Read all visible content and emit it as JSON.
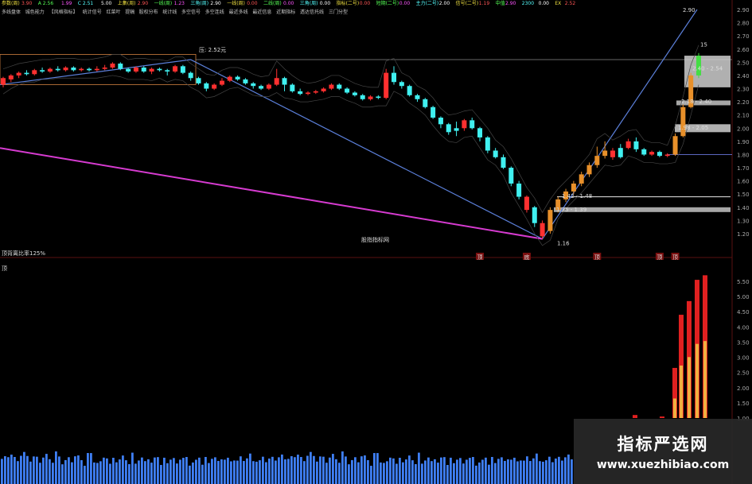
{
  "header": {
    "row1": [
      "参数(周)",
      "3.90",
      "A 2.56",
      "1.99",
      "C 2.51",
      "5.00",
      "上集(周)",
      "2.90",
      "一线(周)",
      "1.23",
      "三角(周)",
      "2.90",
      "一线(周)",
      "0.00",
      "二线(周)",
      "0.00",
      "三角(周)",
      "0.00",
      "指标(二号)",
      "0.00",
      "短期(二号)",
      "0.00",
      "主力(二号)",
      "2.00",
      "信号(二号)",
      "1.19",
      "中值",
      "2.90",
      "2300",
      "0.00",
      "EX",
      "2.52"
    ],
    "row2": [
      "多线盘体",
      "城色能力",
      "【风格指标】",
      "统计信号",
      "红菜叶",
      "提稿",
      "股权分布",
      "统计线",
      "多空信号",
      "多空连线",
      "最近多线",
      "最近信息",
      "近期指标",
      "透达信托线",
      "三门分型"
    ]
  },
  "annotations": {
    "resistance": "压: 2.52元",
    "label_290": "2.90",
    "label_315": "15",
    "box_240": "2.40 - 2.54",
    "box_218": "2.18 - 2.40",
    "box_198": "1.98 - 2.05",
    "box_142": "1.42 - 1.48",
    "box_135": "1.35 - 1.39",
    "low": "1.16",
    "center_text": "股指指标网",
    "left_bottom": "顶背离比率125%",
    "sub_label": "顶",
    "markers": [
      "顶",
      "底",
      "顶",
      "顶",
      "顶"
    ]
  },
  "watermark": {
    "title": "指标严选网",
    "url": "www.xuezhibiao.com"
  },
  "colors": {
    "up": "#ff3030",
    "down": "#40f0f0",
    "yellow_up": "#e8902a",
    "trend": "#5b7fd9",
    "magenta": "#d63bd0",
    "volume": "#3f7ff5"
  },
  "chart_data": {
    "type": "candlestick",
    "y_axis_ticks": [
      "2.90",
      "2.80",
      "2.70",
      "2.60",
      "2.50",
      "2.40",
      "2.30",
      "2.20",
      "2.10",
      "2.00",
      "1.90",
      "1.80",
      "1.70",
      "1.60",
      "1.50",
      "1.40",
      "1.30",
      "1.20"
    ],
    "sub_axis_ticks": [
      "5.50",
      "5.00",
      "4.50",
      "4.00",
      "3.50",
      "3.00",
      "2.50",
      "2.00",
      "1.50",
      "1.00"
    ],
    "candles": [
      [
        2.33,
        2.38,
        2.31,
        2.39,
        "u"
      ],
      [
        2.37,
        2.4,
        2.35,
        2.41,
        "u"
      ],
      [
        2.4,
        2.42,
        2.38,
        2.43,
        "u"
      ],
      [
        2.42,
        2.41,
        2.4,
        2.44,
        "d"
      ],
      [
        2.41,
        2.44,
        2.4,
        2.45,
        "u"
      ],
      [
        2.44,
        2.43,
        2.42,
        2.46,
        "d"
      ],
      [
        2.43,
        2.45,
        2.42,
        2.46,
        "u"
      ],
      [
        2.45,
        2.44,
        2.43,
        2.47,
        "d"
      ],
      [
        2.44,
        2.46,
        2.43,
        2.47,
        "u"
      ],
      [
        2.46,
        2.44,
        2.43,
        2.47,
        "d"
      ],
      [
        2.44,
        2.45,
        2.43,
        2.46,
        "u"
      ],
      [
        2.45,
        2.44,
        2.43,
        2.46,
        "d"
      ],
      [
        2.44,
        2.45,
        2.43,
        2.47,
        "u"
      ],
      [
        2.45,
        2.46,
        2.44,
        2.48,
        "u"
      ],
      [
        2.46,
        2.49,
        2.45,
        2.5,
        "u"
      ],
      [
        2.49,
        2.45,
        2.44,
        2.5,
        "d"
      ],
      [
        2.45,
        2.43,
        2.42,
        2.46,
        "d"
      ],
      [
        2.43,
        2.46,
        2.42,
        2.47,
        "u"
      ],
      [
        2.46,
        2.43,
        2.42,
        2.47,
        "d"
      ],
      [
        2.43,
        2.45,
        2.41,
        2.46,
        "u"
      ],
      [
        2.45,
        2.44,
        2.43,
        2.46,
        "d"
      ],
      [
        2.44,
        2.43,
        2.4,
        2.45,
        "d"
      ],
      [
        2.43,
        2.47,
        2.42,
        2.48,
        "u"
      ],
      [
        2.47,
        2.42,
        2.41,
        2.48,
        "d"
      ],
      [
        2.42,
        2.38,
        2.36,
        2.43,
        "d"
      ],
      [
        2.38,
        2.34,
        2.33,
        2.39,
        "d"
      ],
      [
        2.34,
        2.3,
        2.28,
        2.35,
        "d"
      ],
      [
        2.3,
        2.33,
        2.29,
        2.34,
        "u"
      ],
      [
        2.33,
        2.36,
        2.32,
        2.38,
        "u"
      ],
      [
        2.36,
        2.39,
        2.35,
        2.4,
        "u"
      ],
      [
        2.39,
        2.37,
        2.36,
        2.4,
        "d"
      ],
      [
        2.37,
        2.34,
        2.33,
        2.38,
        "d"
      ],
      [
        2.34,
        2.32,
        2.3,
        2.35,
        "d"
      ],
      [
        2.32,
        2.3,
        2.29,
        2.33,
        "d"
      ],
      [
        2.3,
        2.33,
        2.29,
        2.34,
        "u"
      ],
      [
        2.33,
        2.38,
        2.32,
        2.45,
        "u"
      ],
      [
        2.38,
        2.33,
        2.28,
        2.39,
        "d"
      ],
      [
        2.33,
        2.28,
        2.27,
        2.34,
        "d"
      ],
      [
        2.28,
        2.26,
        2.25,
        2.3,
        "d"
      ],
      [
        2.26,
        2.27,
        2.25,
        2.28,
        "u"
      ],
      [
        2.27,
        2.28,
        2.26,
        2.29,
        "u"
      ],
      [
        2.28,
        2.3,
        2.27,
        2.31,
        "u"
      ],
      [
        2.3,
        2.33,
        2.29,
        2.34,
        "u"
      ],
      [
        2.33,
        2.3,
        2.29,
        2.34,
        "d"
      ],
      [
        2.3,
        2.27,
        2.26,
        2.31,
        "d"
      ],
      [
        2.27,
        2.25,
        2.24,
        2.28,
        "d"
      ],
      [
        2.25,
        2.22,
        2.21,
        2.26,
        "d"
      ],
      [
        2.22,
        2.24,
        2.21,
        2.25,
        "u"
      ],
      [
        2.24,
        2.23,
        2.22,
        2.25,
        "d"
      ],
      [
        2.23,
        2.42,
        2.22,
        2.45,
        "u"
      ],
      [
        2.42,
        2.35,
        2.33,
        2.47,
        "d"
      ],
      [
        2.35,
        2.32,
        2.3,
        2.36,
        "d"
      ],
      [
        2.32,
        2.25,
        2.24,
        2.33,
        "d"
      ],
      [
        2.25,
        2.22,
        2.2,
        2.26,
        "d"
      ],
      [
        2.22,
        2.16,
        2.15,
        2.23,
        "d"
      ],
      [
        2.16,
        2.08,
        2.07,
        2.17,
        "d"
      ],
      [
        2.08,
        2.03,
        2.0,
        2.09,
        "d"
      ],
      [
        2.03,
        1.97,
        1.95,
        2.04,
        "d"
      ],
      [
        2.0,
        1.98,
        1.94,
        2.05,
        "d"
      ],
      [
        2.0,
        2.06,
        1.98,
        2.07,
        "u"
      ],
      [
        2.06,
        2.0,
        1.99,
        2.08,
        "d"
      ],
      [
        2.0,
        1.93,
        1.9,
        2.01,
        "d"
      ],
      [
        1.93,
        1.83,
        1.81,
        1.94,
        "d"
      ],
      [
        1.83,
        1.78,
        1.77,
        1.85,
        "d"
      ],
      [
        1.78,
        1.7,
        1.69,
        1.8,
        "d"
      ],
      [
        1.7,
        1.58,
        1.56,
        1.71,
        "d"
      ],
      [
        1.58,
        1.48,
        1.46,
        1.6,
        "d"
      ],
      [
        1.48,
        1.38,
        1.36,
        1.49,
        "u"
      ],
      [
        1.4,
        1.28,
        1.25,
        1.41,
        "d"
      ],
      [
        1.28,
        1.18,
        1.16,
        1.3,
        "u"
      ],
      [
        1.22,
        1.38,
        1.2,
        1.4,
        "y"
      ],
      [
        1.38,
        1.46,
        1.36,
        1.48,
        "y"
      ],
      [
        1.46,
        1.52,
        1.44,
        1.54,
        "y"
      ],
      [
        1.52,
        1.58,
        1.5,
        1.6,
        "y"
      ],
      [
        1.58,
        1.65,
        1.56,
        1.67,
        "y"
      ],
      [
        1.65,
        1.72,
        1.63,
        1.74,
        "y"
      ],
      [
        1.72,
        1.79,
        1.7,
        1.86,
        "y"
      ],
      [
        1.79,
        1.83,
        1.77,
        1.9,
        "y"
      ],
      [
        1.83,
        1.78,
        1.76,
        1.85,
        "u"
      ],
      [
        1.78,
        1.85,
        1.77,
        1.88,
        "d"
      ],
      [
        1.85,
        1.9,
        1.84,
        1.92,
        "u"
      ],
      [
        1.9,
        1.84,
        1.82,
        1.93,
        "d"
      ],
      [
        1.84,
        1.8,
        1.79,
        1.85,
        "d"
      ],
      [
        1.8,
        1.82,
        1.79,
        1.83,
        "u"
      ],
      [
        1.82,
        1.79,
        1.78,
        1.83,
        "d"
      ],
      [
        1.79,
        1.8,
        1.78,
        1.81,
        "u"
      ],
      [
        1.8,
        1.94,
        1.79,
        1.96,
        "y"
      ],
      [
        1.94,
        2.16,
        1.93,
        2.18,
        "y"
      ],
      [
        2.16,
        2.4,
        2.15,
        2.42,
        "y"
      ],
      [
        2.4,
        2.55,
        2.38,
        2.57,
        "g"
      ]
    ],
    "volume": [
      0.62,
      0.55,
      0.58,
      0.7,
      0.52,
      0.48,
      0.65,
      0.6,
      0.57,
      0.5,
      0.68,
      0.54,
      0.46,
      0.63,
      0.58,
      0.52,
      0.49,
      0.61,
      0.56,
      0.44,
      0.59,
      0.53,
      0.47,
      0.66,
      0.55,
      0.5,
      0.42,
      0.58,
      0.63,
      0.48,
      0.52,
      0.45,
      0.57,
      0.61,
      0.39,
      0.55,
      0.5,
      0.46,
      0.58,
      0.53,
      0.49,
      0.62,
      0.44,
      0.56,
      0.51,
      0.48,
      0.57,
      0.4,
      0.54,
      0.6,
      0.47,
      0.52,
      0.45,
      0.58,
      0.5,
      0.43,
      0.56,
      0.49,
      0.55,
      0.41,
      0.53,
      0.48,
      0.57,
      0.46,
      0.52,
      0.44,
      0.58,
      0.5,
      0.47,
      0.55,
      0.6,
      0.52,
      0.49,
      0.56,
      0.45,
      0.58,
      0.53,
      0.48,
      0.62,
      0.51,
      0.55,
      0.47,
      0.59,
      0.52,
      0.49,
      0.57,
      0.54,
      0.5,
      0.6,
      0.55
    ],
    "sub_bars": [
      [
        1.1,
        0
      ],
      [
        1.05,
        0
      ],
      [
        0.0,
        0
      ],
      [
        2.65,
        1
      ],
      [
        4.4,
        1
      ],
      [
        4.85,
        1
      ],
      [
        5.55,
        1
      ],
      [
        5.7,
        1
      ]
    ]
  }
}
